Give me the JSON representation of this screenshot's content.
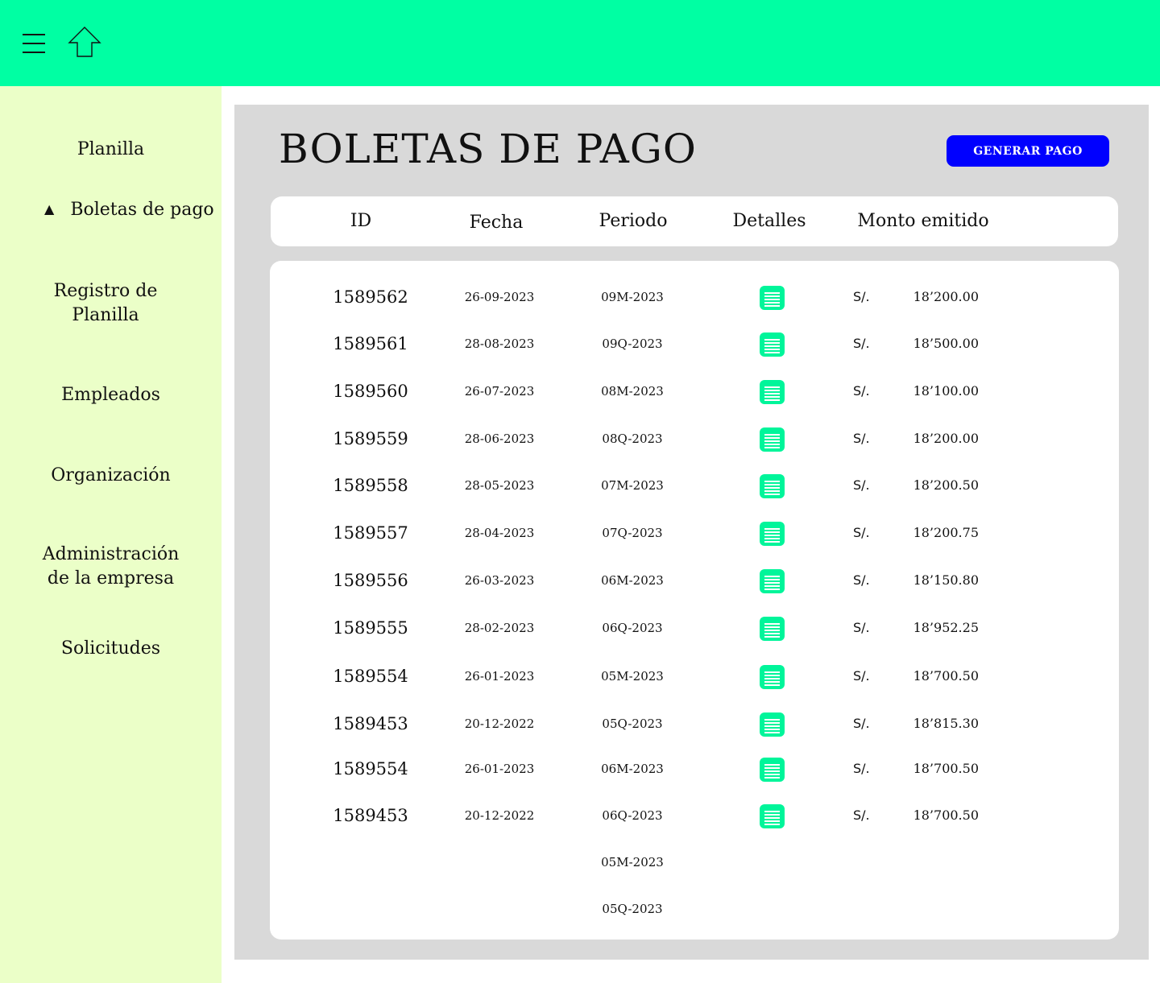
{
  "colors": {
    "topbar": "#00FFA3",
    "sidebar": "#EBFFC8",
    "panel": "#D9D9D9",
    "accent": "#0000FF",
    "detail_icon": "#00F59A"
  },
  "topbar": {
    "menu_icon": "hamburger-menu-icon",
    "home_icon": "home-arrow-icon"
  },
  "sidebar": {
    "items": [
      {
        "label": "Planilla"
      },
      {
        "label": "Boletas de pago",
        "active": true,
        "icon": "triangle-up-icon",
        "icon_glyph": "▲"
      },
      {
        "label": "Registro de Planilla"
      },
      {
        "label": "Empleados"
      },
      {
        "label": "Organización"
      },
      {
        "label": "Administración de la empresa"
      },
      {
        "label": "Solicitudes"
      }
    ]
  },
  "main": {
    "title": "BOLETAS DE PAGO",
    "generate_button": "GENERAR PAGO",
    "columns": [
      "ID",
      "Fecha",
      "Periodo",
      "Detalles",
      "Monto emitido"
    ],
    "rows": [
      {
        "id": "1589562",
        "fecha": "26-09-2023",
        "periodo": "09M-2023",
        "currency": "S/.",
        "monto": "18’200.00"
      },
      {
        "id": "1589561",
        "fecha": "28-08-2023",
        "periodo": "09Q-2023",
        "currency": "S/.",
        "monto": "18’500.00"
      },
      {
        "id": "1589560",
        "fecha": "26-07-2023",
        "periodo": "08M-2023",
        "currency": "S/.",
        "monto": "18’100.00"
      },
      {
        "id": "1589559",
        "fecha": "28-06-2023",
        "periodo": "08Q-2023",
        "currency": "S/.",
        "monto": "18’200.00"
      },
      {
        "id": "1589558",
        "fecha": "28-05-2023",
        "periodo": "07M-2023",
        "currency": "S/.",
        "monto": "18’200.50"
      },
      {
        "id": "1589557",
        "fecha": "28-04-2023",
        "periodo": "07Q-2023",
        "currency": "S/.",
        "monto": "18’200.75"
      },
      {
        "id": "1589556",
        "fecha": "26-03-2023",
        "periodo": "06M-2023",
        "currency": "S/.",
        "monto": "18’150.80"
      },
      {
        "id": "1589555",
        "fecha": "28-02-2023",
        "periodo": "06Q-2023",
        "currency": "S/.",
        "monto": "18’952.25"
      },
      {
        "id": "1589554",
        "fecha": "26-01-2023",
        "periodo": "05M-2023",
        "currency": "S/.",
        "monto": "18’700.50"
      },
      {
        "id": "1589453",
        "fecha": "20-12-2022",
        "periodo": "05Q-2023",
        "currency": "S/.",
        "monto": "18’815.30"
      },
      {
        "id": "1589554",
        "fecha": "26-01-2023",
        "periodo": "06M-2023",
        "currency": "S/.",
        "monto": "18’700.50"
      },
      {
        "id": "1589453",
        "fecha": "20-12-2022",
        "periodo": "06Q-2023",
        "currency": "S/.",
        "monto": "18’700.50"
      }
    ],
    "extra_periods": [
      "05M-2023",
      "05Q-2023"
    ]
  }
}
